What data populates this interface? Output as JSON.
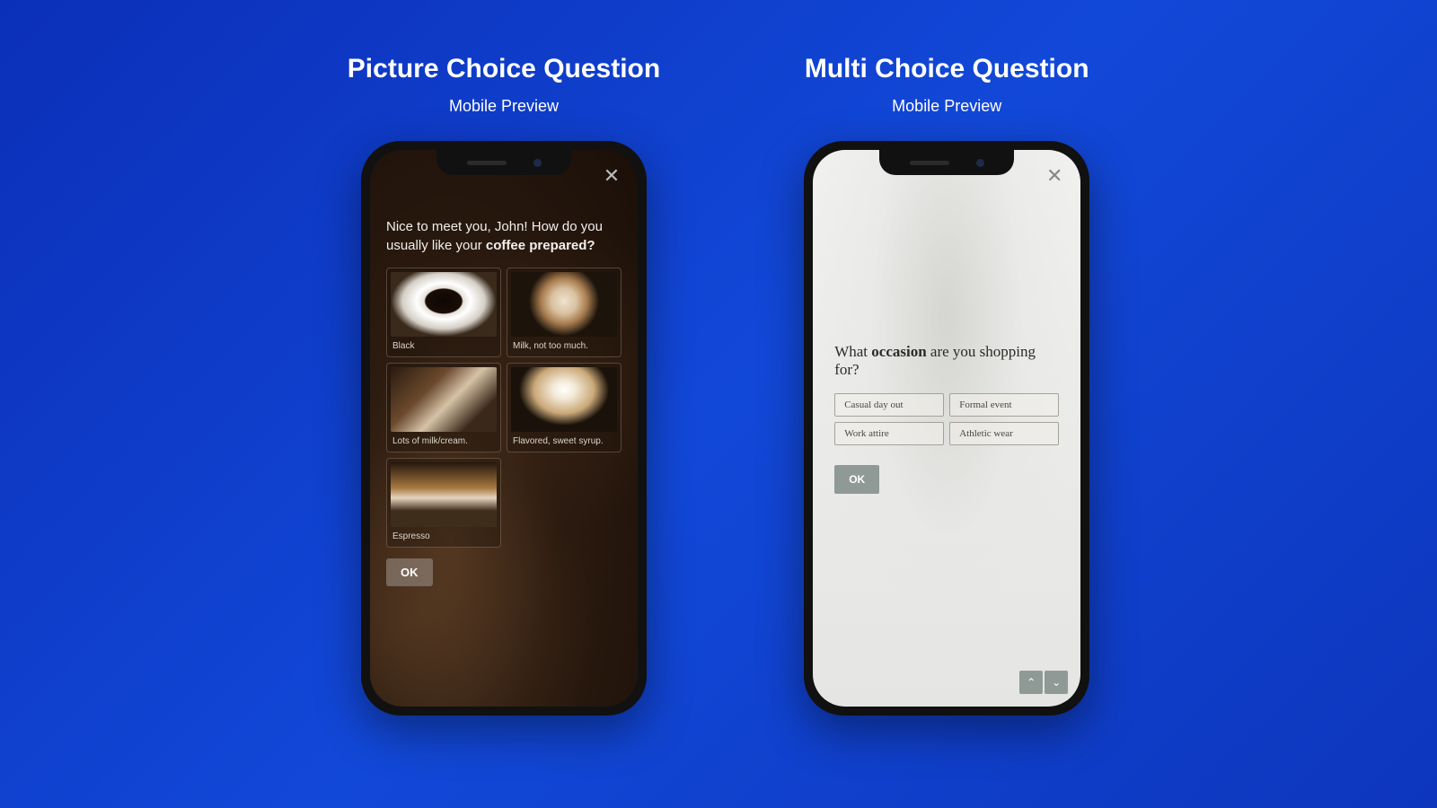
{
  "left": {
    "title": "Picture Choice Question",
    "subtitle": "Mobile Preview",
    "question_pre": "Nice to meet you, John! How do you usually like your ",
    "question_bold": "coffee prepared?",
    "options": [
      {
        "label": "Black"
      },
      {
        "label": "Milk, not too much."
      },
      {
        "label": "Lots of milk/cream."
      },
      {
        "label": "Flavored, sweet syrup."
      },
      {
        "label": "Espresso"
      }
    ],
    "ok": "OK"
  },
  "right": {
    "title": "Multi Choice Question",
    "subtitle": "Mobile Preview",
    "question_pre": "What ",
    "question_bold": "occasion",
    "question_post": " are you shopping for?",
    "options": [
      {
        "label": "Casual day out"
      },
      {
        "label": "Formal event"
      },
      {
        "label": "Work attire"
      },
      {
        "label": "Athletic wear"
      }
    ],
    "ok": "OK"
  }
}
